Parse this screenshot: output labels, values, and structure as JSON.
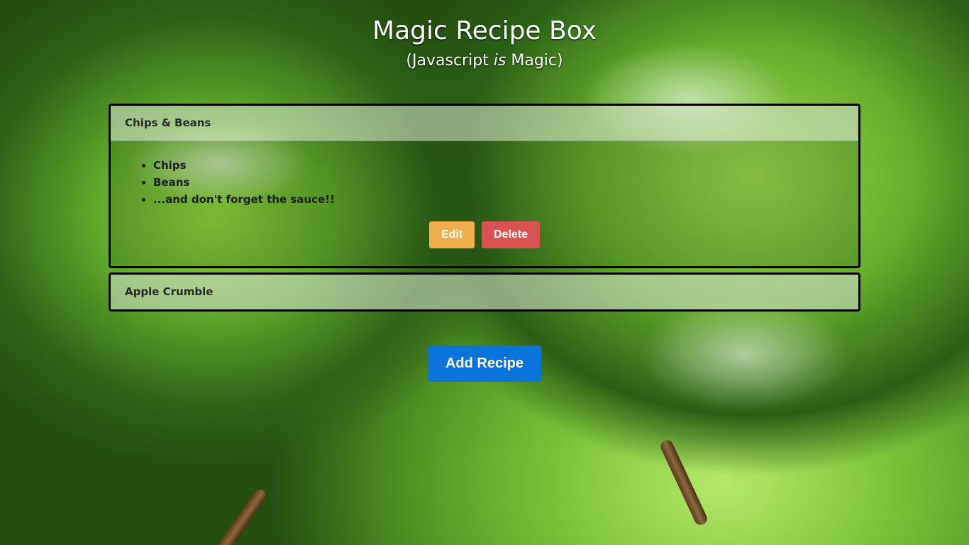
{
  "header": {
    "title": "Magic Recipe Box",
    "subtitle_prefix": "(Javascript ",
    "subtitle_emphasis": "is",
    "subtitle_suffix": " Magic)"
  },
  "recipes": [
    {
      "name": "Chips & Beans",
      "expanded": true,
      "ingredients": [
        "Chips",
        "Beans",
        "...and don't forget the sauce!!"
      ],
      "edit_label": "Edit",
      "delete_label": "Delete"
    },
    {
      "name": "Apple Crumble",
      "expanded": false
    }
  ],
  "add_button_label": "Add Recipe",
  "colors": {
    "edit": "#f0ad4e",
    "delete": "#d9534f",
    "add": "#0a74da"
  }
}
